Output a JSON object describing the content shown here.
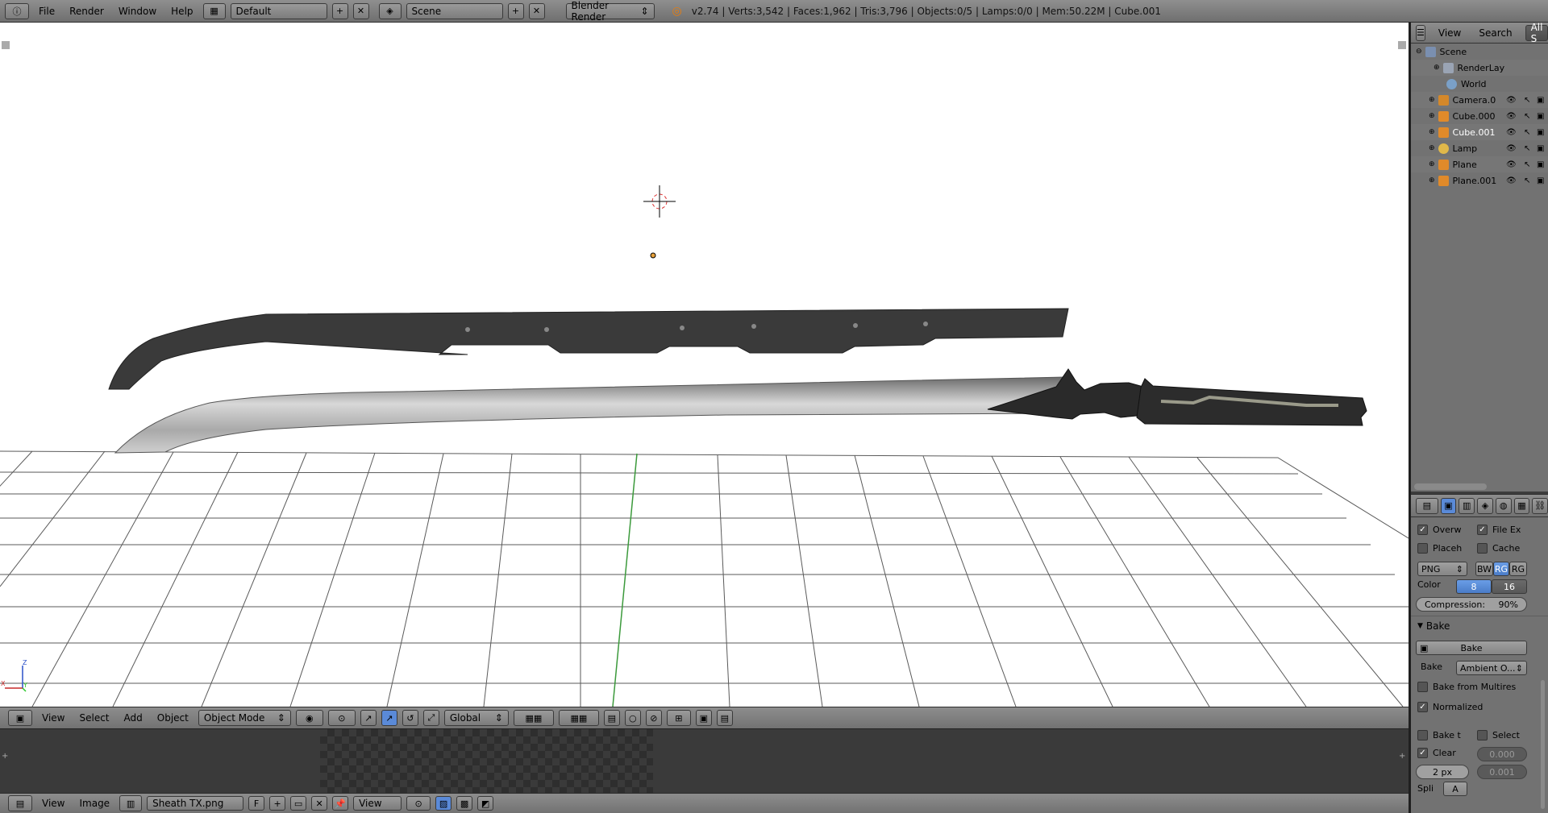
{
  "topbar": {
    "menus": [
      "File",
      "Render",
      "Window",
      "Help"
    ],
    "layout": "Default",
    "scene": "Scene",
    "engine": "Blender Render",
    "stats": "v2.74 | Verts:3,542 | Faces:1,962 | Tris:3,796 | Objects:0/5 | Lamps:0/0 | Mem:50.22M | Cube.001"
  },
  "viewport_header": {
    "menus": [
      "View",
      "Select",
      "Add",
      "Object"
    ],
    "mode": "Object Mode",
    "orientation": "Global"
  },
  "image_header": {
    "menus": [
      "View",
      "Image"
    ],
    "image_name": "Sheath TX.png",
    "f_label": "F",
    "view_label": "View"
  },
  "outliner": {
    "header": [
      "View",
      "Search",
      "All S"
    ],
    "items": [
      {
        "name": "Scene",
        "icon": "scene-icon"
      },
      {
        "name": "RenderLay",
        "icon": "render-layers-icon"
      },
      {
        "name": "World",
        "icon": "world-icon"
      },
      {
        "name": "Camera.0",
        "icon": "camera-icon"
      },
      {
        "name": "Cube.000",
        "icon": "mesh-icon"
      },
      {
        "name": "Cube.001",
        "icon": "mesh-icon"
      },
      {
        "name": "Lamp",
        "icon": "lamp-icon"
      },
      {
        "name": "Plane",
        "icon": "mesh-icon"
      },
      {
        "name": "Plane.001",
        "icon": "mesh-icon"
      }
    ]
  },
  "properties": {
    "overwrite": "Overw",
    "file_ext": "File Ex",
    "placeholders": "Placeh",
    "cache": "Cache",
    "format": "PNG",
    "bw": "BW",
    "rgb": "RG",
    "rgba": "RG",
    "color_label": "Color",
    "depth_8": "8",
    "depth_16": "16",
    "compression": "Compression:",
    "compression_value": "90%",
    "bake_panel": "Bake",
    "bake_button": "Bake",
    "bake_label": "Bake",
    "bake_mode": "Ambient O...",
    "bake_from_multires": "Bake from Multires",
    "normalized": "Normalized",
    "bake_to": "Bake t",
    "select": "Select",
    "clear": "Clear",
    "clear_value": "0.000",
    "margin": "2 px",
    "margin_value": "0.001",
    "split": "Spli",
    "split_value": "A"
  },
  "axis": {
    "x": "X",
    "y": "Y",
    "z": "Z"
  }
}
